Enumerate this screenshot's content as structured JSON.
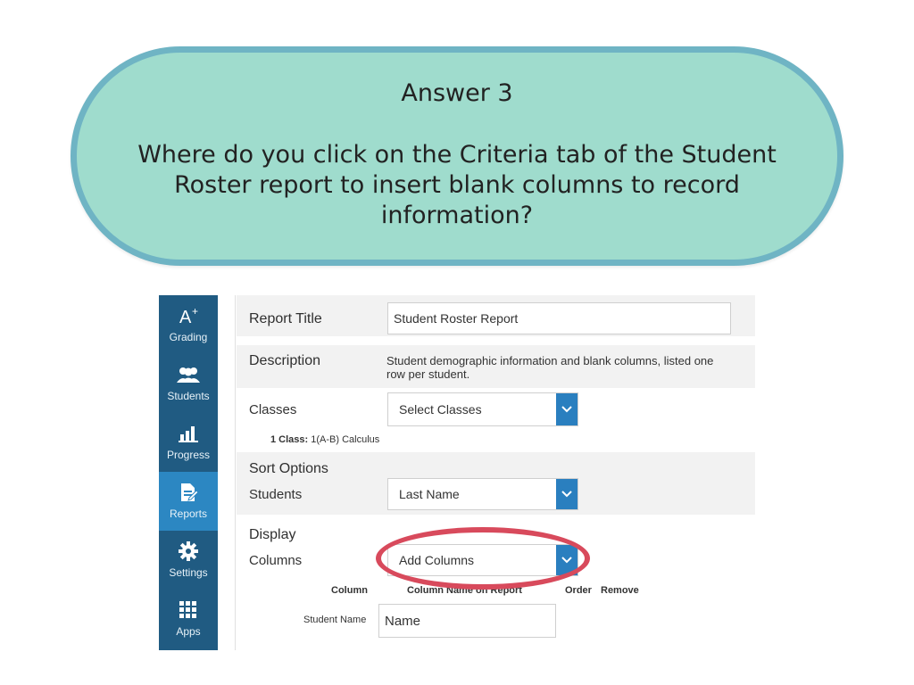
{
  "callout": {
    "title": "Answer 3",
    "question": "Where do you click on the Criteria tab of the Student Roster report to insert blank columns to record information?"
  },
  "sidebar": {
    "items": [
      {
        "label": "Grading",
        "icon": "grading-icon"
      },
      {
        "label": "Students",
        "icon": "students-icon"
      },
      {
        "label": "Progress",
        "icon": "progress-icon"
      },
      {
        "label": "Reports",
        "icon": "reports-icon",
        "active": true
      },
      {
        "label": "Settings",
        "icon": "gear-icon"
      },
      {
        "label": "Apps",
        "icon": "apps-grid-icon"
      }
    ]
  },
  "form": {
    "report_title_label": "Report Title",
    "report_title_value": "Student Roster Report",
    "description_label": "Description",
    "description_value": "Student demographic information and blank columns, listed one row per student.",
    "classes_label": "Classes",
    "classes_select": "Select Classes",
    "classes_count_label": "1 Class:",
    "classes_count_value": "1(A-B) Calculus",
    "sort_options_heading": "Sort Options",
    "students_label": "Students",
    "students_select": "Last Name",
    "display_heading": "Display",
    "columns_label": "Columns",
    "columns_select": "Add Columns",
    "table_headers": {
      "column": "Column",
      "column_name": "Column Name on Report",
      "order": "Order",
      "remove": "Remove"
    },
    "row_label": "Student Name",
    "row_value": "Name"
  },
  "colors": {
    "callout_fill": "#9fdccd",
    "callout_border": "#6fb4c4",
    "sidebar": "#205b82",
    "sidebar_active": "#2c87c2",
    "select_caret": "#2a7fbf",
    "highlight": "#d84a5c"
  }
}
